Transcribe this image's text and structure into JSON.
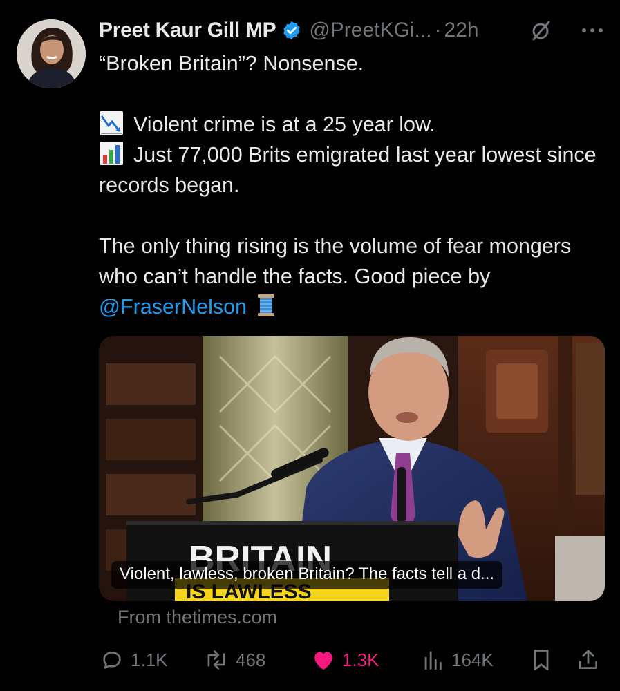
{
  "author": {
    "display_name": "Preet Kaur Gill MP",
    "handle": "@PreetKGi...",
    "separator": "·",
    "time": "22h",
    "verified": true,
    "verified_color": "#1d9bf0"
  },
  "tweet": {
    "line1": "“Broken Britain”? Nonsense.",
    "line2": "Violent crime is at a 25 year low.",
    "line3": "Just 77,000 Brits emigrated last year lowest since records began.",
    "line4_start": "The only thing rising is the volume of fear mongers who can’t handle the facts. Good piece by ",
    "mention": "@FraserNelson",
    "emoji_icons": [
      "chart-decreasing-icon",
      "bar-chart-icon",
      "thread-spool-icon"
    ]
  },
  "card": {
    "caption": "Violent, lawless, broken Britain? The facts tell a d...",
    "source": "From thetimes.com",
    "image_sign_text_top": "BRITAIN",
    "image_sign_text_bottom": "IS LAWLESS"
  },
  "actions": {
    "replies": "1.1K",
    "reposts": "468",
    "likes": "1.3K",
    "views": "164K",
    "like_color": "#f91880",
    "muted_color": "#71767b"
  }
}
